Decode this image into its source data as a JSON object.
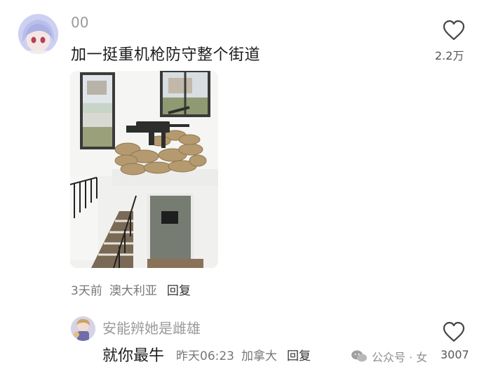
{
  "comment": {
    "username": "00",
    "text": "加一挺重机枪防守整个街道",
    "likes": "2.2万",
    "meta": {
      "time": "3天前",
      "location": "澳大利亚",
      "reply_label": "回复"
    }
  },
  "reply": {
    "username": "安能辨她是雌雄",
    "text": "就你最牛",
    "time": "昨天06:23",
    "location": "加拿大",
    "reply_label": "回复",
    "likes": "3007"
  },
  "watermark": {
    "text": "公众号 · 女"
  },
  "icons": {
    "like": "heart-outline-icon",
    "watermark": "wechat-icon"
  },
  "colors": {
    "username": "#9a9a9a",
    "text": "#1c1c1c",
    "meta": "#777777"
  }
}
